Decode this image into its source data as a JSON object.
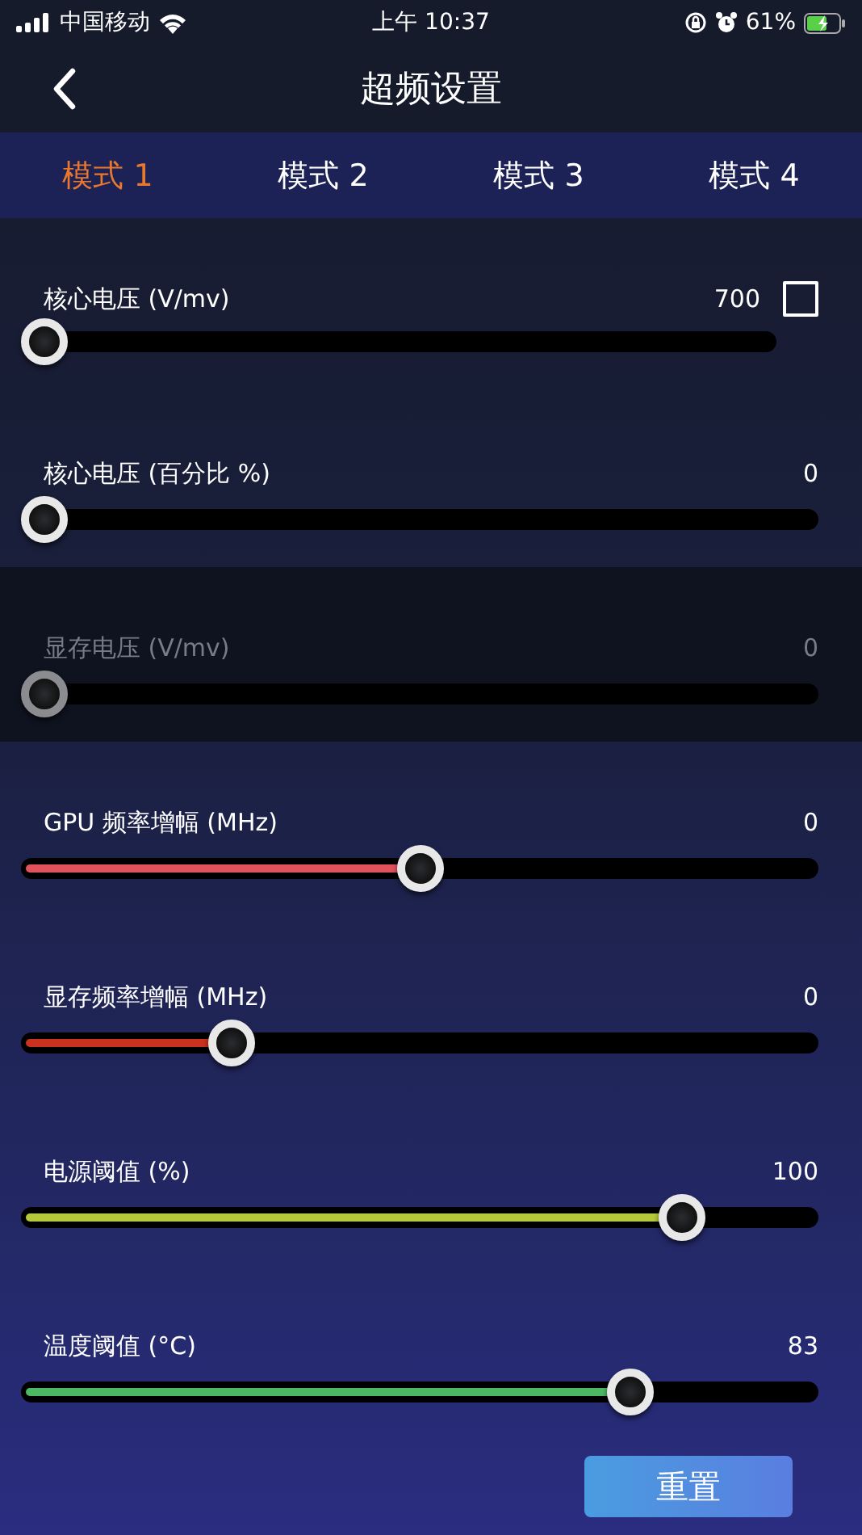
{
  "status_bar": {
    "carrier": "中国移动",
    "time": "上午 10:37",
    "battery": "61%"
  },
  "nav": {
    "title": "超频设置"
  },
  "tabs": [
    {
      "label": "模式 1",
      "selected": true
    },
    {
      "label": "模式 2",
      "selected": false
    },
    {
      "label": "模式 3",
      "selected": false
    },
    {
      "label": "模式 4",
      "selected": false
    }
  ],
  "sliders": [
    {
      "kind": "checkbox",
      "label": "核心电压 (V/mv)",
      "reading": "700",
      "level": 0,
      "checked": false,
      "disabled": false
    },
    {
      "kind": "plain",
      "label": "核心电压 (百分比 %)",
      "reading": "0",
      "level": 0,
      "disabled": false
    },
    {
      "kind": "plain",
      "label": "显存电压 (V/mv)",
      "reading": "0",
      "level": 0,
      "disabled": true
    },
    {
      "kind": "plain",
      "label": "GPU 频率增幅 (MHz)",
      "reading": "0",
      "level": 0.5,
      "color": "#e0525c",
      "disabled": false
    },
    {
      "kind": "plain",
      "label": "显存频率增幅 (MHz)",
      "reading": "0",
      "level": 0.25,
      "color": "#c8321f",
      "disabled": false
    },
    {
      "kind": "plain",
      "label": "电源阈值 (%)",
      "reading": "100",
      "level": 0.85,
      "color": "#b4c83a",
      "disabled": false
    },
    {
      "kind": "plain",
      "label": "温度阈值 (°C)",
      "reading": "83",
      "level": 0.78,
      "color": "#4cb864",
      "disabled": false
    }
  ],
  "reset_button": "重置"
}
